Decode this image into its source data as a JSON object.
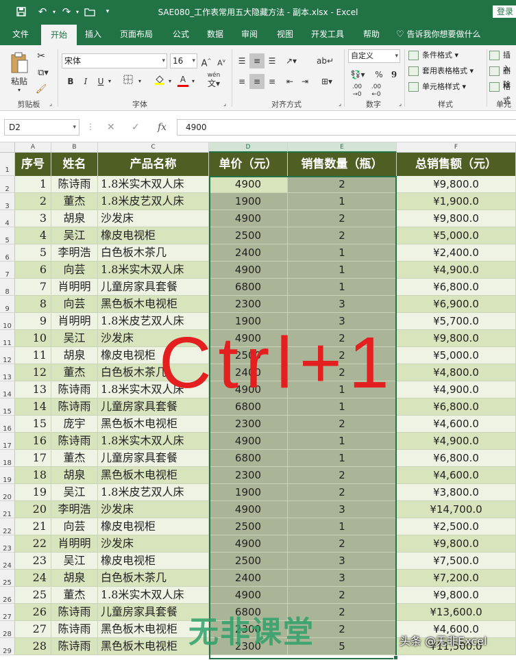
{
  "titlebar": {
    "title": "SAE080_工作表常用五大隐藏方法 - 副本.xlsx  -  Excel",
    "login": "登录"
  },
  "tabs": [
    "文件",
    "开始",
    "插入",
    "页面布局",
    "公式",
    "数据",
    "审阅",
    "视图",
    "开发工具",
    "帮助"
  ],
  "tell_me": "告诉我你想要做什么",
  "ribbon": {
    "paste_label": "粘贴",
    "groups": {
      "clipboard": "剪贴板",
      "font": "字体",
      "alignment": "对齐方式",
      "number": "数字",
      "styles": "样式",
      "cells": "单元"
    },
    "font_name": "宋体",
    "font_size": "16",
    "number_format": "自定义",
    "cond_format": "条件格式",
    "table_format": "套用表格格式",
    "cell_style": "单元格样式",
    "insert": "插入",
    "delete": "删除",
    "format": "格式",
    "wen_label": "wén",
    "percent": "%",
    "comma": "9",
    "dec_inc": ".00",
    "dec_dec": ".00"
  },
  "formula_bar": {
    "name_box": "D2",
    "value": "4900",
    "fx": "fx"
  },
  "columns": [
    "A",
    "B",
    "C",
    "D",
    "E",
    "F"
  ],
  "rows": [
    "1",
    "2",
    "3",
    "4",
    "5",
    "6",
    "7",
    "8",
    "9",
    "10",
    "11",
    "12",
    "13",
    "14",
    "15",
    "16",
    "17",
    "18",
    "19",
    "20",
    "21",
    "22",
    "23",
    "24",
    "25",
    "26",
    "27",
    "28",
    "29"
  ],
  "table": {
    "headers": [
      "序号",
      "姓名",
      "产品名称",
      "单价（元）",
      "销售数量（瓶）",
      "总销售额（元）"
    ],
    "rows": [
      [
        "1",
        "陈诗雨",
        "1.8米实木双人床",
        "4900",
        "2",
        "¥9,800.0"
      ],
      [
        "2",
        "董杰",
        "1.8米皮艺双人床",
        "1900",
        "1",
        "¥1,900.0"
      ],
      [
        "3",
        "胡泉",
        "沙发床",
        "4900",
        "2",
        "¥9,800.0"
      ],
      [
        "4",
        "吴江",
        "橡皮电视柜",
        "2500",
        "2",
        "¥5,000.0"
      ],
      [
        "5",
        "李明浩",
        "白色板木茶几",
        "2400",
        "1",
        "¥2,400.0"
      ],
      [
        "6",
        "向芸",
        "1.8米实木双人床",
        "4900",
        "1",
        "¥4,900.0"
      ],
      [
        "7",
        "肖明明",
        "儿童房家具套餐",
        "6800",
        "1",
        "¥6,800.0"
      ],
      [
        "8",
        "向芸",
        "黑色板木电视柜",
        "2300",
        "3",
        "¥6,900.0"
      ],
      [
        "9",
        "肖明明",
        "1.8米皮艺双人床",
        "1900",
        "3",
        "¥5,700.0"
      ],
      [
        "10",
        "吴江",
        "沙发床",
        "4900",
        "2",
        "¥9,800.0"
      ],
      [
        "11",
        "胡泉",
        "橡皮电视柜",
        "2500",
        "2",
        "¥5,000.0"
      ],
      [
        "12",
        "董杰",
        "白色板木茶几",
        "2400",
        "2",
        "¥4,800.0"
      ],
      [
        "13",
        "陈诗雨",
        "1.8米实木双人床",
        "4900",
        "1",
        "¥4,900.0"
      ],
      [
        "14",
        "陈诗雨",
        "儿童房家具套餐",
        "6800",
        "1",
        "¥6,800.0"
      ],
      [
        "15",
        "庞宇",
        "黑色板木电视柜",
        "2300",
        "2",
        "¥4,600.0"
      ],
      [
        "16",
        "陈诗雨",
        "1.8米实木双人床",
        "4900",
        "1",
        "¥4,900.0"
      ],
      [
        "17",
        "董杰",
        "儿童房家具套餐",
        "6800",
        "1",
        "¥6,800.0"
      ],
      [
        "18",
        "胡泉",
        "黑色板木电视柜",
        "2300",
        "2",
        "¥4,600.0"
      ],
      [
        "19",
        "吴江",
        "1.8米皮艺双人床",
        "1900",
        "2",
        "¥3,800.0"
      ],
      [
        "20",
        "李明浩",
        "沙发床",
        "4900",
        "3",
        "¥14,700.0"
      ],
      [
        "21",
        "向芸",
        "橡皮电视柜",
        "2500",
        "1",
        "¥2,500.0"
      ],
      [
        "22",
        "肖明明",
        "沙发床",
        "4900",
        "2",
        "¥9,800.0"
      ],
      [
        "23",
        "吴江",
        "橡皮电视柜",
        "2500",
        "3",
        "¥7,500.0"
      ],
      [
        "24",
        "胡泉",
        "白色板木茶几",
        "2400",
        "3",
        "¥7,200.0"
      ],
      [
        "25",
        "董杰",
        "1.8米实木双人床",
        "4900",
        "2",
        "¥9,800.0"
      ],
      [
        "26",
        "陈诗雨",
        "儿童房家具套餐",
        "6800",
        "2",
        "¥13,600.0"
      ],
      [
        "27",
        "陈诗雨",
        "黑色板木电视柜",
        "2300",
        "2",
        "¥4,600.0"
      ],
      [
        "28",
        "陈诗雨",
        "黑色板木电视柜",
        "2300",
        "5",
        "¥11,500.0"
      ]
    ]
  },
  "overlay": {
    "shortcut": "Ctrl+1",
    "watermark": "无非课堂",
    "attribution": "头条 @无非Excel"
  },
  "colors": {
    "excel_green": "#217346",
    "header_bg": "#4f5f24",
    "band_light": "#eef3e4",
    "band_dark": "#d8e4bc",
    "selection_tint": "#a9b596",
    "overlay_red": "#e41f1f"
  }
}
